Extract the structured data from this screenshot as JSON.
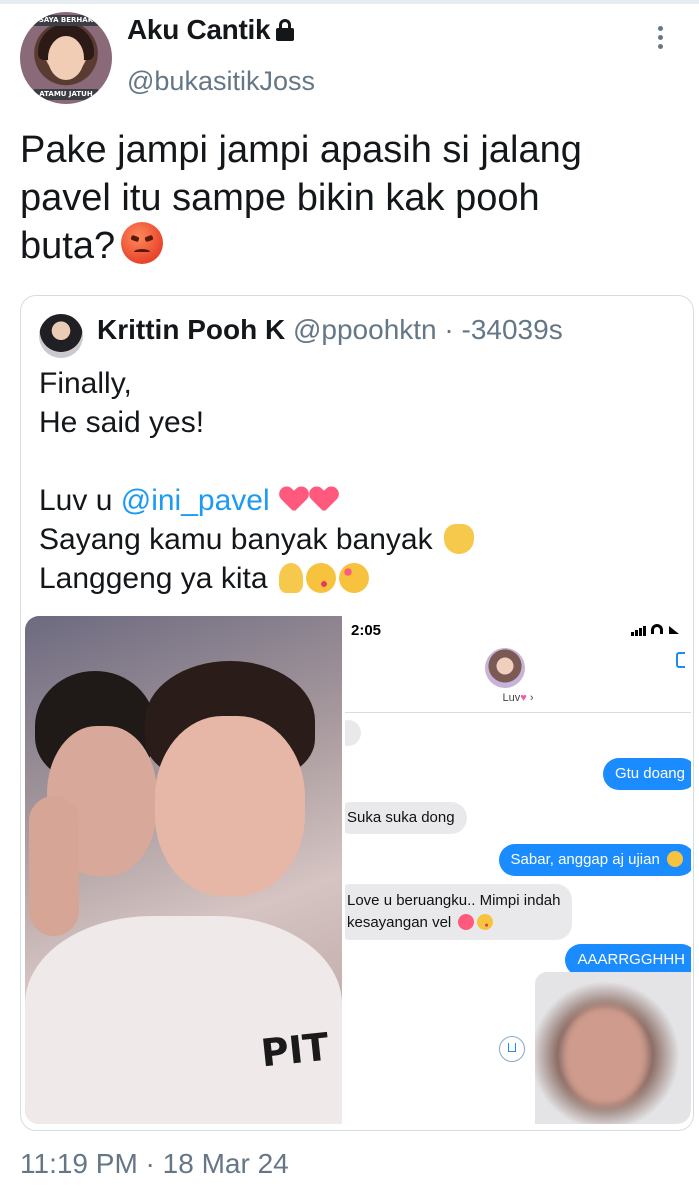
{
  "author": {
    "name": "Aku Cantik",
    "handle": "@bukasitikJoss",
    "avatar_caption_top": "SAYA BERHAK",
    "avatar_caption_bottom": "ATAMU JATUH",
    "protected_icon": "lock-icon"
  },
  "tweet": {
    "lines": [
      "Pake jampi jampi apasih si jalang",
      "pavel itu sampe bikin kak pooh",
      "buta?"
    ],
    "emoji": "angry-face-icon",
    "timestamp": "11:19 PM · 18 Mar 24"
  },
  "quoted": {
    "name": "Krittin Pooh K",
    "handle_meta": "@ppoohktn · -34039s",
    "line1": "Finally,",
    "line2": "He said yes!",
    "line4_prefix": "Luv u ",
    "mention": "@ini_pavel",
    "line5": "Sayang kamu banyak banyak",
    "line6": "Langgeng ya kita"
  },
  "chat_screenshot": {
    "time": "2:05",
    "contact": "Luv",
    "messages": [
      {
        "dir": "out",
        "text": "Gtu doang"
      },
      {
        "dir": "in",
        "text": "Suka suka dong"
      },
      {
        "dir": "out",
        "text": "Sabar, anggap aj ujian"
      },
      {
        "dir": "in",
        "text": "Love u beruangku.. Mimpi indah"
      },
      {
        "dir": "in",
        "text": "kesayangan vel"
      },
      {
        "dir": "out",
        "text": "AAARRGGHHH"
      }
    ]
  },
  "photo": {
    "shirt_print": "PIT"
  },
  "colors": {
    "text": "#14171a",
    "secondary": "#657786",
    "link": "#1d9bf0",
    "imessage_blue": "#1a8cff",
    "border": "#d4dde3"
  }
}
